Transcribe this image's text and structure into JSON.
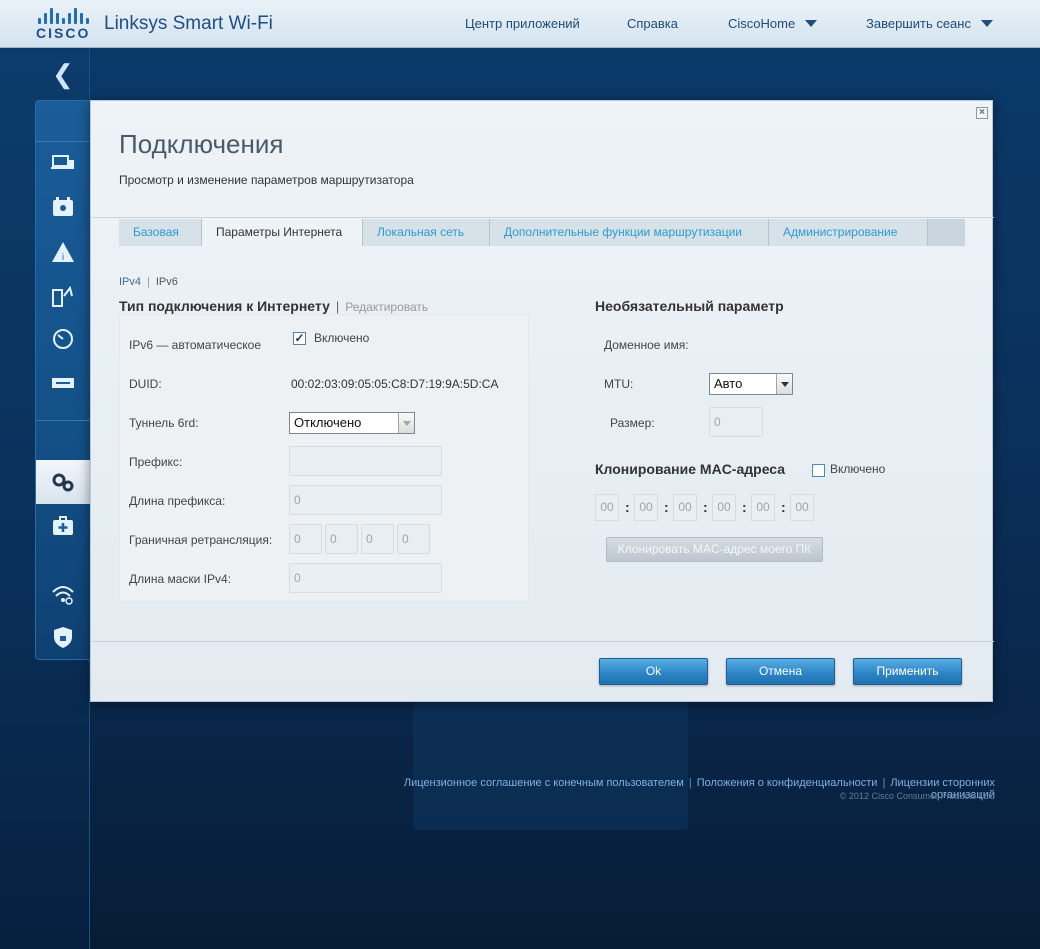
{
  "header": {
    "logo_text": "CISCO",
    "brand": "Linksys Smart Wi-Fi",
    "nav": {
      "app_center": "Центр приложений",
      "help": "Справка",
      "router_name": "CiscoHome",
      "logout": "Завершить сеанс"
    }
  },
  "rail": {
    "icons": [
      "back-arrow-icon",
      "devices-icon",
      "parental-calendar-icon",
      "guest-warning-icon",
      "media-priority-icon",
      "speedtest-icon",
      "usb-storage-icon",
      "connectivity-gear-icon",
      "troubleshooting-icon",
      "wireless-icon",
      "security-icon"
    ]
  },
  "modal": {
    "title": "Подключения",
    "subtitle": "Просмотр и изменение параметров маршрутизатора",
    "tabs": [
      {
        "label": "Базовая",
        "active": false
      },
      {
        "label": "Параметры Интернета",
        "active": true
      },
      {
        "label": "Локальная сеть",
        "active": false
      },
      {
        "label": "Дополнительные функции маршрутизации",
        "active": false
      },
      {
        "label": "Администрирование",
        "active": false
      }
    ],
    "ip_versions": {
      "ipv4": "IPv4",
      "ipv6": "IPv6"
    },
    "left": {
      "title": "Тип подключения к Интернету",
      "edit": "Редактировать",
      "rows": {
        "ipv6_auto_label": "IPv6 — автоматическое",
        "enabled_label": "Включено",
        "duid_label": "DUID:",
        "duid_value": "00:02:03:09:05:05:C8:D7:19:9A:5D:CA",
        "tunnel_label": "Туннель 6rd:",
        "tunnel_value": "Отключено",
        "prefix_label": "Префикс:",
        "prefix_value": "",
        "prefix_len_label": "Длина префикса:",
        "prefix_len_value": "0",
        "relay_label": "Граничная ретрансляция:",
        "relay_octets": [
          "0",
          "0",
          "0",
          "0"
        ],
        "mask_label": "Длина маски IPv4:",
        "mask_value": "0"
      }
    },
    "right": {
      "title": "Необязательный параметр",
      "domain_label": "Доменное имя:",
      "mtu_label": "MTU:",
      "mtu_value": "Авто",
      "size_label": "Размер:",
      "size_value": "0",
      "mac_title": "Клонирование MAC-адреса",
      "mac_enabled_label": "Включено",
      "mac_octets": [
        "00",
        "00",
        "00",
        "00",
        "00",
        "00"
      ],
      "clone_button": "Клонировать MAC-адрес моего ПК"
    },
    "buttons": {
      "ok": "Ok",
      "cancel": "Отмена",
      "apply": "Применить"
    }
  },
  "footer": {
    "eula": "Лицензионное соглашение с конечным пользователем",
    "privacy": "Положения о конфиденциальности",
    "third_party": "Лицензии сторонних организаций",
    "copyright": "© 2012 Cisco Consumer Products LLC"
  },
  "colors": {
    "accent": "#2d86c7",
    "link": "#2c9bd1",
    "background": "#0a3360"
  }
}
